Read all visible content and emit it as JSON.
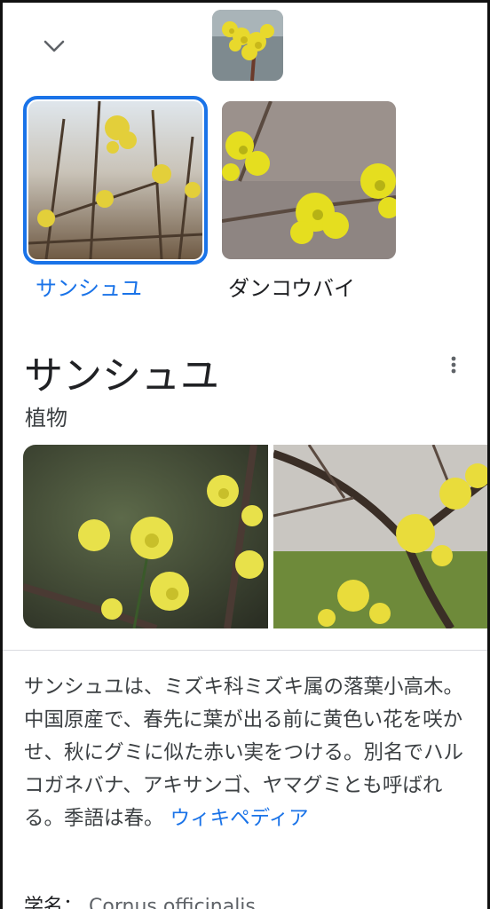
{
  "header": {
    "back_icon": "chevron-down-icon"
  },
  "entities": [
    {
      "label": "サンシュユ",
      "selected": true
    },
    {
      "label": "ダンコウバイ",
      "selected": false
    }
  ],
  "knowledge_panel": {
    "title": "サンシュユ",
    "subtitle": "植物",
    "more_icon": "more-vert-icon",
    "description": "サンシュユは、ミズキ科ミズキ属の落葉小高木。中国原産で、春先に葉が出る前に黄色い花を咲かせ、秋にグミに似た赤い実をつける。別名でハルコガネバナ、アキサンゴ、ヤマグミとも呼ばれる。季語は春。",
    "source_link": "ウィキペディア",
    "scientific_name_label": "学名：",
    "scientific_name_value": "Cornus officinalis"
  },
  "colors": {
    "accent": "#1a73e8",
    "text": "#202124",
    "secondary": "#5f6368"
  }
}
